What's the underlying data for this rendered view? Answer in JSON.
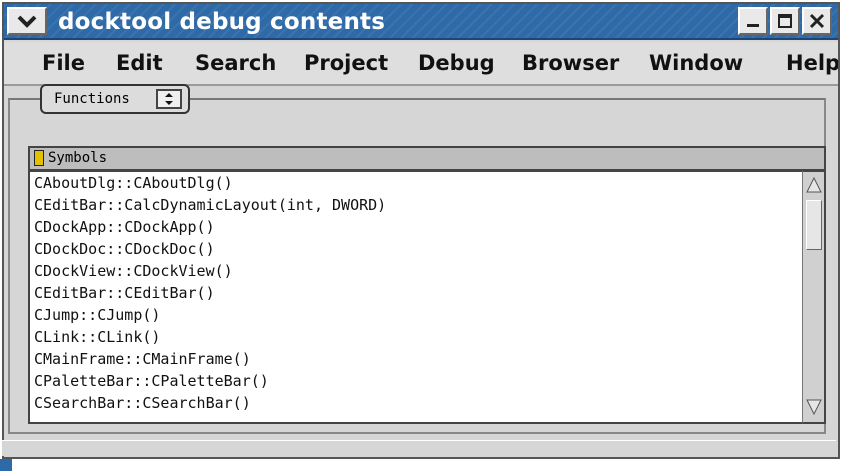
{
  "window": {
    "title": "docktool debug contents"
  },
  "menubar": {
    "items": [
      "File",
      "Edit",
      "Search",
      "Project",
      "Debug",
      "Browser",
      "Window",
      "Help"
    ]
  },
  "combo": {
    "selected": "Functions"
  },
  "list": {
    "header": "Symbols",
    "rows": [
      "CAboutDlg::CAboutDlg()",
      "CEditBar::CalcDynamicLayout(int, DWORD)",
      "CDockApp::CDockApp()",
      "CDockDoc::CDockDoc()",
      "CDockView::CDockView()",
      "CEditBar::CEditBar()",
      "CJump::CJump()",
      "CLink::CLink()",
      "CMainFrame::CMainFrame()",
      "CPaletteBar::CPaletteBar()",
      "CSearchBar::CSearchBar()"
    ]
  },
  "colors": {
    "titlebar": "#2f6aa8",
    "window_bg": "#d6d6d6"
  },
  "icons": {
    "window_menu": "chevron-down-icon",
    "minimize": "minimize-icon",
    "maximize": "maximize-icon",
    "close": "close-icon",
    "sort": "sort-indicator-icon",
    "combo": "up-down-arrows-icon"
  }
}
